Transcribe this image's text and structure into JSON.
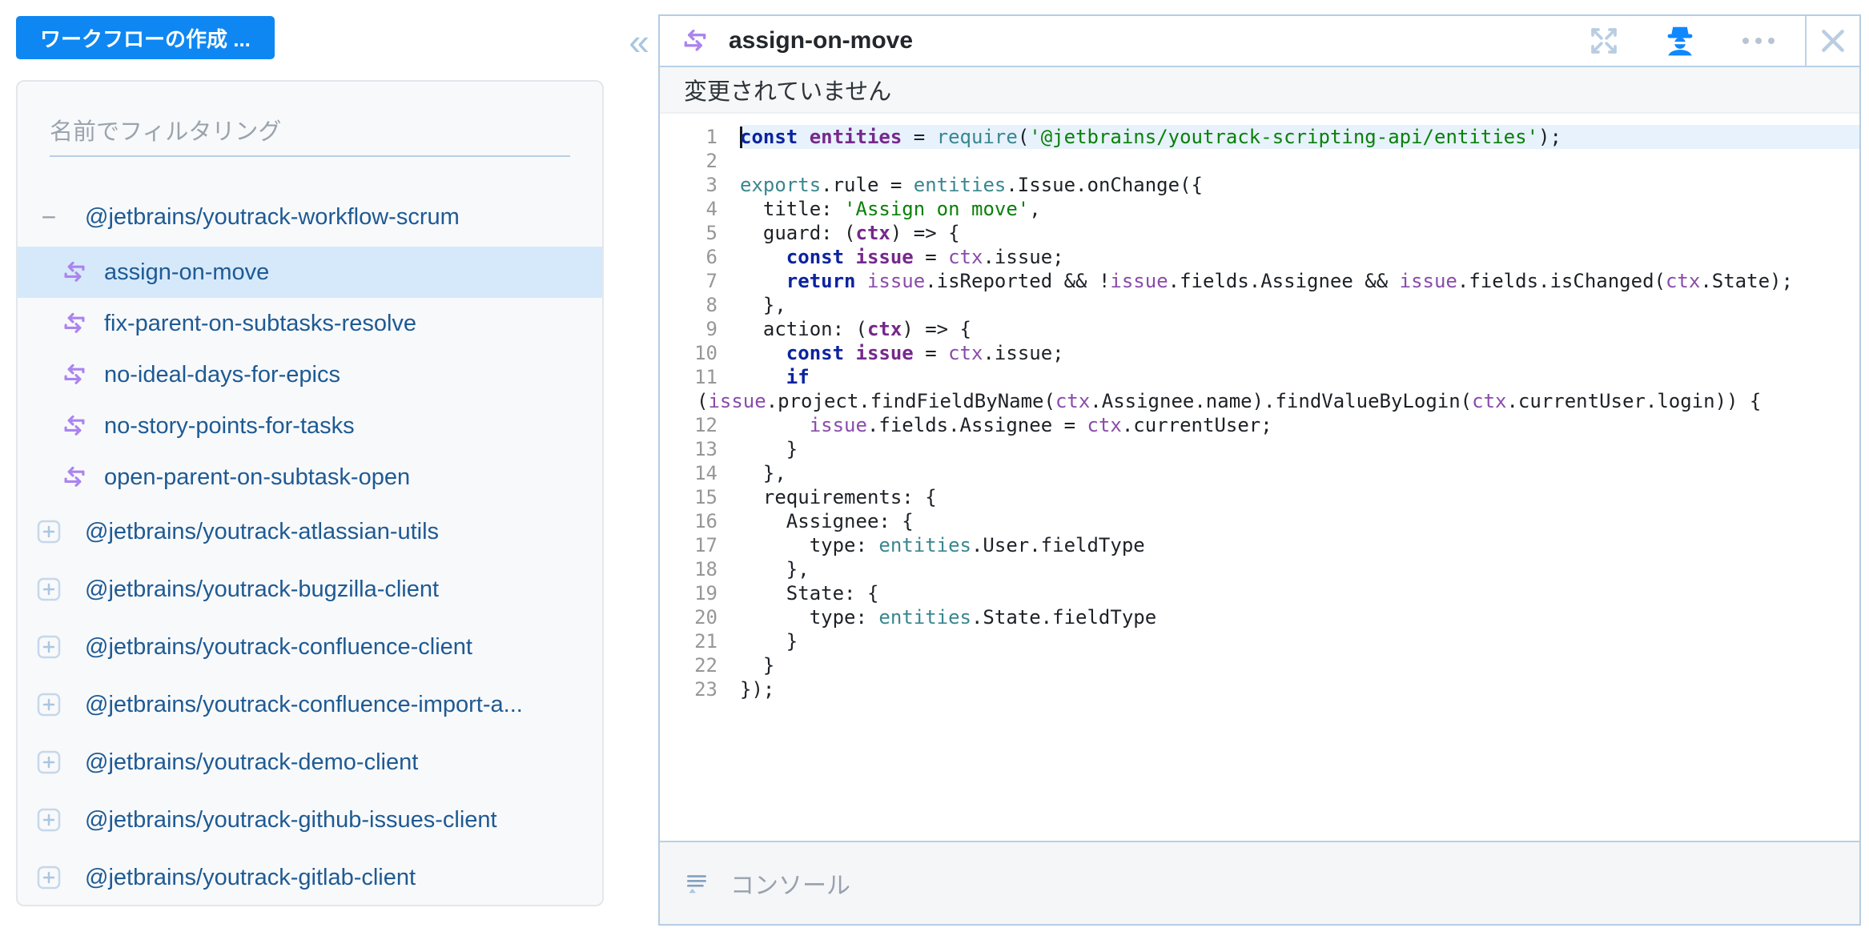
{
  "colors": {
    "accent_blue": "#0e87f2",
    "selection_blue": "#d6e9fb",
    "tree_text": "#1e5a93",
    "rule_icon_purple": "#ab84ee",
    "panel_border": "#b6cde2",
    "debug_icon_blue": "#0f87ff",
    "syntax_keyword": "#0b23a0",
    "syntax_definition": "#76288c",
    "syntax_variable": "#8a4bab",
    "syntax_module": "#39868f",
    "syntax_string": "#0a800a",
    "current_line_bg": "#e7f2fc"
  },
  "sidebar": {
    "create_button": "ワークフローの作成 ...",
    "collapse_icon": "«",
    "filter_placeholder": "名前でフィルタリング",
    "groups": [
      {
        "label": "@jetbrains/youtrack-workflow-scrum",
        "expanded": true,
        "rules": [
          {
            "label": "assign-on-move",
            "selected": true
          },
          {
            "label": "fix-parent-on-subtasks-resolve",
            "selected": false
          },
          {
            "label": "no-ideal-days-for-epics",
            "selected": false
          },
          {
            "label": "no-story-points-for-tasks",
            "selected": false
          },
          {
            "label": "open-parent-on-subtask-open",
            "selected": false
          }
        ]
      },
      {
        "label": "@jetbrains/youtrack-atlassian-utils",
        "expanded": false
      },
      {
        "label": "@jetbrains/youtrack-bugzilla-client",
        "expanded": false
      },
      {
        "label": "@jetbrains/youtrack-confluence-client",
        "expanded": false
      },
      {
        "label": "@jetbrains/youtrack-confluence-import-a...",
        "expanded": false
      },
      {
        "label": "@jetbrains/youtrack-demo-client",
        "expanded": false
      },
      {
        "label": "@jetbrains/youtrack-github-issues-client",
        "expanded": false
      },
      {
        "label": "@jetbrains/youtrack-gitlab-client",
        "expanded": false
      }
    ]
  },
  "editor": {
    "title": "assign-on-move",
    "status_message": "変更されていません",
    "console_label": "コンソール",
    "code": {
      "lines": [
        {
          "n": 1,
          "hl": true,
          "cursor": true,
          "seg": [
            [
              "k",
              "const"
            ],
            [
              "p",
              " "
            ],
            [
              "d",
              "entities"
            ],
            [
              "p",
              " = "
            ],
            [
              "m",
              "require"
            ],
            [
              "p",
              "("
            ],
            [
              "s",
              "'@jetbrains/youtrack-scripting-api/entities'"
            ],
            [
              "p",
              ");"
            ]
          ]
        },
        {
          "n": 2,
          "seg": []
        },
        {
          "n": 3,
          "seg": [
            [
              "m",
              "exports"
            ],
            [
              "p",
              ".rule = "
            ],
            [
              "m",
              "entities"
            ],
            [
              "p",
              ".Issue.onChange({"
            ]
          ]
        },
        {
          "n": 4,
          "seg": [
            [
              "p",
              "  title: "
            ],
            [
              "s",
              "'Assign on move'"
            ],
            [
              "p",
              ","
            ]
          ]
        },
        {
          "n": 5,
          "seg": [
            [
              "p",
              "  guard: ("
            ],
            [
              "d",
              "ctx"
            ],
            [
              "p",
              ") => {"
            ]
          ]
        },
        {
          "n": 6,
          "seg": [
            [
              "p",
              "    "
            ],
            [
              "k",
              "const"
            ],
            [
              "p",
              " "
            ],
            [
              "d",
              "issue"
            ],
            [
              "p",
              " = "
            ],
            [
              "v",
              "ctx"
            ],
            [
              "p",
              ".issue;"
            ]
          ]
        },
        {
          "n": 7,
          "seg": [
            [
              "p",
              "    "
            ],
            [
              "k",
              "return"
            ],
            [
              "p",
              " "
            ],
            [
              "v",
              "issue"
            ],
            [
              "p",
              ".isReported && !"
            ],
            [
              "v",
              "issue"
            ],
            [
              "p",
              ".fields.Assignee && "
            ],
            [
              "v",
              "issue"
            ],
            [
              "p",
              ".fields.isChanged("
            ],
            [
              "v",
              "ctx"
            ],
            [
              "p",
              ".State);"
            ]
          ]
        },
        {
          "n": 8,
          "seg": [
            [
              "p",
              "  },"
            ]
          ]
        },
        {
          "n": 9,
          "seg": [
            [
              "p",
              "  action: ("
            ],
            [
              "d",
              "ctx"
            ],
            [
              "p",
              ") => {"
            ]
          ]
        },
        {
          "n": 10,
          "seg": [
            [
              "p",
              "    "
            ],
            [
              "k",
              "const"
            ],
            [
              "p",
              " "
            ],
            [
              "d",
              "issue"
            ],
            [
              "p",
              " = "
            ],
            [
              "v",
              "ctx"
            ],
            [
              "p",
              ".issue;"
            ]
          ]
        },
        {
          "n": 11,
          "seg": [
            [
              "p",
              "    "
            ],
            [
              "k",
              "if"
            ]
          ],
          "wrap": [
            [
              "p",
              "("
            ],
            [
              "v",
              "issue"
            ],
            [
              "p",
              ".project.findFieldByName("
            ],
            [
              "v",
              "ctx"
            ],
            [
              "p",
              ".Assignee.name).findValueByLogin("
            ],
            [
              "v",
              "ctx"
            ],
            [
              "p",
              ".currentUser.login)) {"
            ]
          ]
        },
        {
          "n": 12,
          "seg": [
            [
              "p",
              "      "
            ],
            [
              "v",
              "issue"
            ],
            [
              "p",
              ".fields.Assignee = "
            ],
            [
              "v",
              "ctx"
            ],
            [
              "p",
              ".currentUser;"
            ]
          ]
        },
        {
          "n": 13,
          "seg": [
            [
              "p",
              "    }"
            ]
          ]
        },
        {
          "n": 14,
          "seg": [
            [
              "p",
              "  },"
            ]
          ]
        },
        {
          "n": 15,
          "seg": [
            [
              "p",
              "  requirements: {"
            ]
          ]
        },
        {
          "n": 16,
          "seg": [
            [
              "p",
              "    Assignee: {"
            ]
          ]
        },
        {
          "n": 17,
          "seg": [
            [
              "p",
              "      type: "
            ],
            [
              "m",
              "entities"
            ],
            [
              "p",
              ".User.fieldType"
            ]
          ]
        },
        {
          "n": 18,
          "seg": [
            [
              "p",
              "    },"
            ]
          ]
        },
        {
          "n": 19,
          "seg": [
            [
              "p",
              "    State: {"
            ]
          ]
        },
        {
          "n": 20,
          "seg": [
            [
              "p",
              "      type: "
            ],
            [
              "m",
              "entities"
            ],
            [
              "p",
              ".State.fieldType"
            ]
          ]
        },
        {
          "n": 21,
          "seg": [
            [
              "p",
              "    }"
            ]
          ]
        },
        {
          "n": 22,
          "seg": [
            [
              "p",
              "  }"
            ]
          ]
        },
        {
          "n": 23,
          "seg": [
            [
              "p",
              "});"
            ]
          ]
        }
      ]
    }
  }
}
